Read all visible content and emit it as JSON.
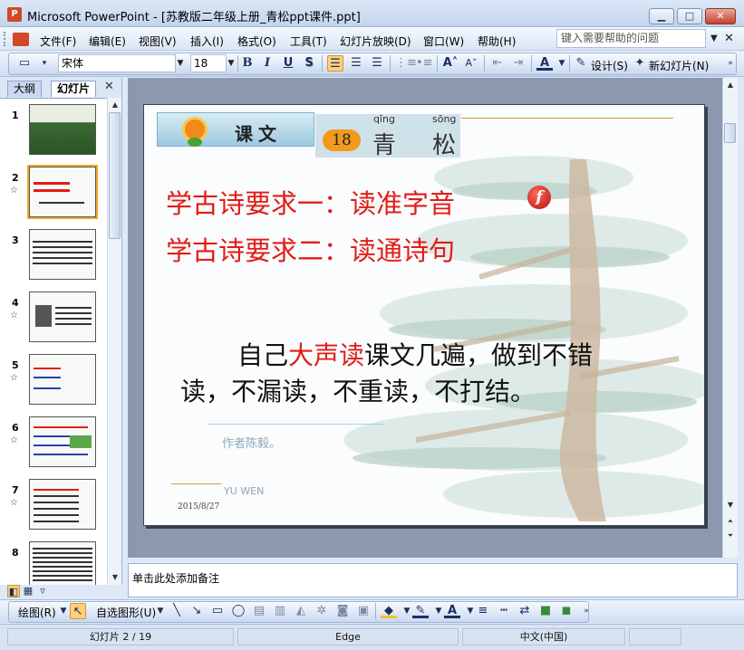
{
  "window": {
    "title": "Microsoft PowerPoint - [苏教版二年级上册_青松ppt课件.ppt]",
    "app_icon_letter": "P",
    "minimize_glyph": "▁",
    "maximize_glyph": "□",
    "close_glyph": "✕"
  },
  "menu": {
    "items": [
      "文件(F)",
      "编辑(E)",
      "视图(V)",
      "插入(I)",
      "格式(O)",
      "工具(T)",
      "幻灯片放映(D)",
      "窗口(W)",
      "帮助(H)"
    ],
    "help_placeholder": "键入需要帮助的问题",
    "dropdown_glyph": "▼",
    "close_glyph": "✕"
  },
  "format_toolbar": {
    "font_name": "宋体",
    "font_size": "18",
    "bold": "B",
    "italic": "I",
    "underline": "U",
    "shadow": "S",
    "design_label": "设计(S)",
    "new_slide_label": "新幻灯片(N)"
  },
  "left_pane": {
    "tab_outline": "大纲",
    "tab_slides": "幻灯片",
    "close_glyph": "✕",
    "slide_numbers": [
      "1",
      "2",
      "3",
      "4",
      "5",
      "6",
      "7",
      "8"
    ],
    "star_glyph": "☆",
    "selected_slide": "2"
  },
  "slide": {
    "header_label": "课文",
    "lesson_number": "18",
    "char1": "青",
    "char1_pinyin": "qīng",
    "char2": "松",
    "char2_pinyin": "sōng",
    "req1": "学古诗要求一：读准字音",
    "req2": "学古诗要求二：读通诗句",
    "flash_glyph": "f",
    "body_part1": "自己",
    "body_highlight": "大声读",
    "body_part2": "课文几遍，做到不错",
    "body_line2": "读，不漏读，不重读，不打结。",
    "faded_author": "作者陈毅。",
    "faded_pinyin": "YU WEN",
    "date": "2015/8/27"
  },
  "notes": {
    "placeholder": "单击此处添加备注"
  },
  "draw_toolbar": {
    "draw_label": "绘图(R)",
    "autoshape_label": "自选图形(U)"
  },
  "status": {
    "slide_position": "幻灯片 2 / 19",
    "design_template": "Edge",
    "language": "中文(中国)"
  },
  "colors": {
    "accent_red": "#e21c16",
    "lesson_orange": "#f29a1b"
  }
}
